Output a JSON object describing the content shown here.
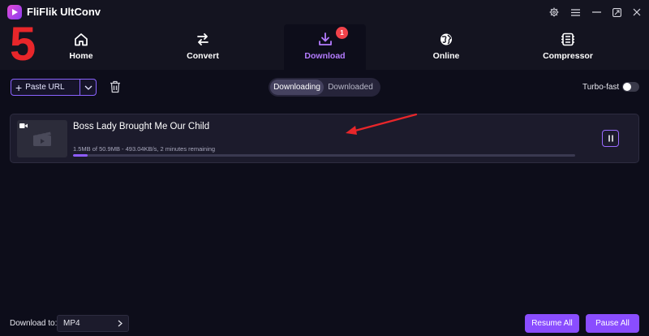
{
  "app": {
    "title": "FliFlik UltConv"
  },
  "step_marker": "5",
  "nav": {
    "tabs": [
      {
        "label": "Home",
        "icon": "home-icon"
      },
      {
        "label": "Convert",
        "icon": "convert-arrows-icon"
      },
      {
        "label": "Download",
        "icon": "download-icon",
        "badge": "1",
        "active": true
      },
      {
        "label": "Online",
        "icon": "globe-icon"
      },
      {
        "label": "Compressor",
        "icon": "compressor-icon"
      }
    ]
  },
  "toolbar": {
    "paste_url_label": "Paste URL",
    "segments": [
      "Downloading",
      "Downloaded"
    ],
    "active_segment": "Downloading",
    "turbo_label": "Turbo-fast",
    "turbo_on": false
  },
  "download_item": {
    "title": "Boss Lady Brought Me Our Child",
    "status": "1.5MB of 50.9MB -  493.04KB/s, 2 minutes remaining",
    "progress_fraction": 0.029
  },
  "footer": {
    "download_to_label": "Download to:",
    "format_value": "MP4",
    "resume_all_label": "Resume All",
    "pause_all_label": "Pause All"
  },
  "colors": {
    "accent": "#8a4dff",
    "active_tab_text": "#b47cff",
    "badge": "#f0424a",
    "step_marker": "#e8262a",
    "annotation_arrow": "#e8262a"
  }
}
